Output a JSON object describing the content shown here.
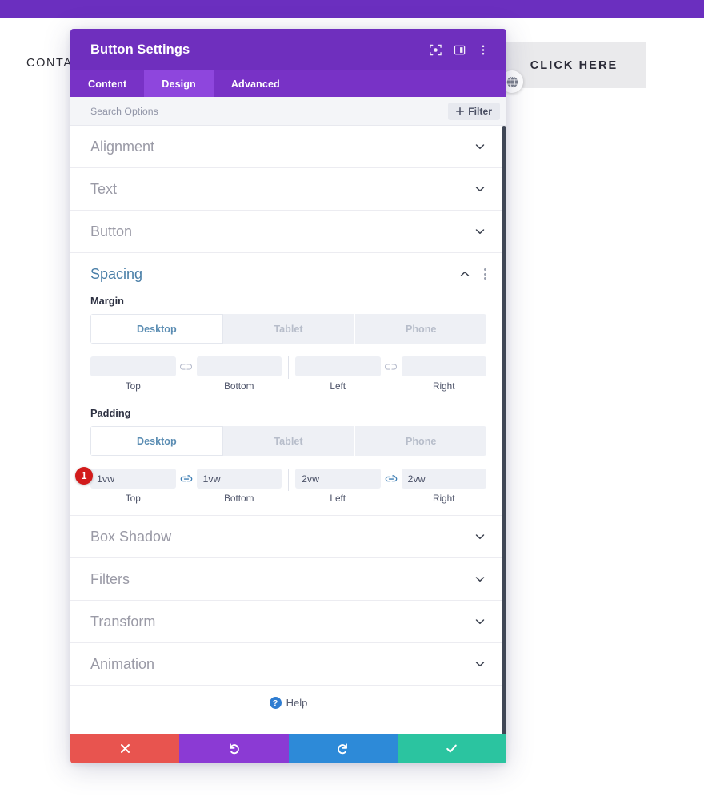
{
  "background": {
    "admin_bar_color": "#6b2fbf",
    "contact_label": "CONTA",
    "click_here_label": "CLICK HERE",
    "globe_icon": "globe-icon"
  },
  "modal": {
    "title": "Button Settings",
    "header_icons": [
      "focus-target-icon",
      "layout-panel-icon",
      "kebab-menu-icon"
    ],
    "tabs": [
      {
        "label": "Content",
        "active": false
      },
      {
        "label": "Design",
        "active": true
      },
      {
        "label": "Advanced",
        "active": false
      }
    ],
    "search": {
      "placeholder": "Search Options",
      "value": ""
    },
    "filter_button": {
      "label": "Filter",
      "icon": "plus-icon"
    },
    "sections": [
      {
        "label": "Alignment",
        "open": false
      },
      {
        "label": "Text",
        "open": false
      },
      {
        "label": "Button",
        "open": false
      }
    ],
    "spacing": {
      "title": "Spacing",
      "accent_color": "#4a7fa8",
      "margin": {
        "label": "Margin",
        "devices": [
          {
            "label": "Desktop",
            "active": true
          },
          {
            "label": "Tablet",
            "active": false
          },
          {
            "label": "Phone",
            "active": false
          }
        ],
        "fields": [
          {
            "caption": "Top",
            "value": "",
            "placeholder": ""
          },
          {
            "caption": "Bottom",
            "value": "",
            "placeholder": ""
          },
          {
            "caption": "Left",
            "value": "",
            "placeholder": ""
          },
          {
            "caption": "Right",
            "value": "",
            "placeholder": ""
          }
        ],
        "link_state": "unlinked"
      },
      "padding": {
        "label": "Padding",
        "devices": [
          {
            "label": "Desktop",
            "active": true
          },
          {
            "label": "Tablet",
            "active": false
          },
          {
            "label": "Phone",
            "active": false
          }
        ],
        "fields": [
          {
            "caption": "Top",
            "value": "1vw",
            "placeholder": ""
          },
          {
            "caption": "Bottom",
            "value": "1vw",
            "placeholder": ""
          },
          {
            "caption": "Left",
            "value": "2vw",
            "placeholder": ""
          },
          {
            "caption": "Right",
            "value": "2vw",
            "placeholder": ""
          }
        ],
        "link_state": "linked",
        "badge": {
          "text": "1",
          "color": "#d21b1b"
        }
      }
    },
    "sections_bottom": [
      {
        "label": "Box Shadow",
        "open": false
      },
      {
        "label": "Filters",
        "open": false
      },
      {
        "label": "Transform",
        "open": false
      },
      {
        "label": "Animation",
        "open": false
      }
    ],
    "help": {
      "label": "Help",
      "icon": "question-mark-icon"
    },
    "footer_buttons": [
      {
        "name": "cancel",
        "icon": "close-x-icon",
        "color": "#e8544f"
      },
      {
        "name": "undo",
        "icon": "undo-arrow-icon",
        "color": "#8b3ad4"
      },
      {
        "name": "redo",
        "icon": "redo-arrow-icon",
        "color": "#2d8ad8"
      },
      {
        "name": "save",
        "icon": "checkmark-icon",
        "color": "#2bc4a0"
      }
    ]
  }
}
